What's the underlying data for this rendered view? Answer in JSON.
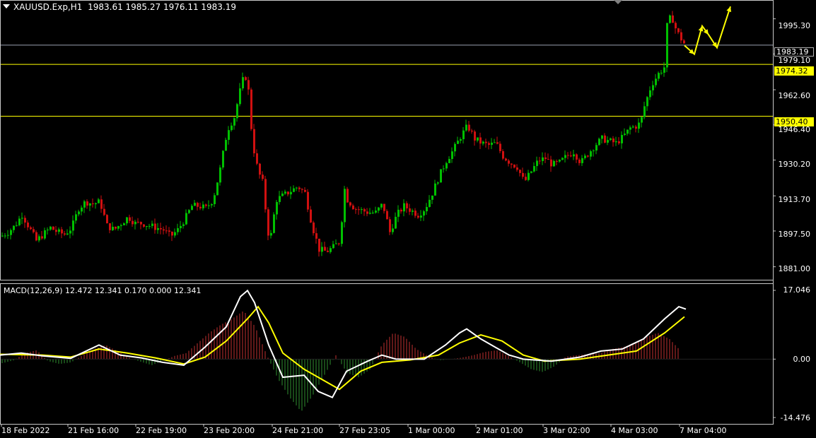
{
  "symbol_bar": {
    "symbol": "XAUUSD.Exp,H1",
    "ohlc": "1983.61 1985.27 1976.11 1983.19"
  },
  "macd_bar": {
    "label": "MACD(12,26,9) 12.472 12.341 0.170 0.000 12.341"
  },
  "price_axis": {
    "ticks": [
      "1995.30",
      "1979.10",
      "1962.60",
      "1946.40",
      "1930.20",
      "1913.70",
      "1897.50",
      "1881.00"
    ],
    "current_tag": "1983.19",
    "level_tags": [
      "1974.32",
      "1950.40"
    ]
  },
  "macd_axis": {
    "ticks": [
      "17.046",
      "0.00",
      "-14.476"
    ]
  },
  "time_axis": {
    "labels": [
      "18 Feb 2022",
      "21 Feb 16:00",
      "22 Feb 19:00",
      "23 Feb 20:00",
      "24 Feb 21:00",
      "27 Feb 23:05",
      "1 Mar 00:00",
      "2 Mar 01:00",
      "3 Mar 02:00",
      "4 Mar 03:00",
      "7 Mar 04:00"
    ]
  },
  "colors": {
    "background": "#000000",
    "bull": "#00c000",
    "bear": "#d01010",
    "level_line": "#ffff00",
    "current_line": "#9aa0b0",
    "macd_main": "#ffffff",
    "macd_signal": "#ffff00",
    "forecast_arrow": "#ffff00"
  },
  "chart_data": {
    "type": "candlestick",
    "instrument": "XAUUSD.Exp",
    "timeframe": "H1",
    "ylim": [
      1876,
      2003
    ],
    "horizontal_levels": [
      1974.32,
      1950.4
    ],
    "current_price": 1983.19,
    "price_path": [
      [
        0,
        1895
      ],
      [
        10,
        1897
      ],
      [
        20,
        1900
      ],
      [
        30,
        1905
      ],
      [
        40,
        1899
      ],
      [
        50,
        1893
      ],
      [
        60,
        1896
      ],
      [
        70,
        1899
      ],
      [
        80,
        1897
      ],
      [
        90,
        1896
      ],
      [
        100,
        1899
      ],
      [
        110,
        1908
      ],
      [
        120,
        1911
      ],
      [
        130,
        1910
      ],
      [
        140,
        1911
      ],
      [
        150,
        1900
      ],
      [
        160,
        1898
      ],
      [
        170,
        1901
      ],
      [
        180,
        1904
      ],
      [
        190,
        1901
      ],
      [
        200,
        1901
      ],
      [
        210,
        1900
      ],
      [
        220,
        1899
      ],
      [
        230,
        1898
      ],
      [
        240,
        1895
      ],
      [
        250,
        1898
      ],
      [
        260,
        1903
      ],
      [
        270,
        1909
      ],
      [
        280,
        1909
      ],
      [
        290,
        1908
      ],
      [
        300,
        1912
      ],
      [
        310,
        1926
      ],
      [
        320,
        1944
      ],
      [
        330,
        1950
      ],
      [
        340,
        1965
      ],
      [
        345,
        1970
      ],
      [
        350,
        1962
      ],
      [
        355,
        1941
      ],
      [
        360,
        1930
      ],
      [
        365,
        1924
      ],
      [
        370,
        1920
      ],
      [
        375,
        1905
      ],
      [
        380,
        1891
      ],
      [
        385,
        1903
      ],
      [
        390,
        1912
      ],
      [
        400,
        1914
      ],
      [
        410,
        1916
      ],
      [
        420,
        1918
      ],
      [
        430,
        1915
      ],
      [
        440,
        1900
      ],
      [
        450,
        1889
      ],
      [
        460,
        1888
      ],
      [
        470,
        1890
      ],
      [
        480,
        1893
      ],
      [
        485,
        1918
      ],
      [
        490,
        1912
      ],
      [
        500,
        1908
      ],
      [
        510,
        1907
      ],
      [
        520,
        1906
      ],
      [
        530,
        1906
      ],
      [
        540,
        1910
      ],
      [
        550,
        1897
      ],
      [
        560,
        1905
      ],
      [
        570,
        1909
      ],
      [
        580,
        1907
      ],
      [
        590,
        1905
      ],
      [
        600,
        1908
      ],
      [
        610,
        1915
      ],
      [
        620,
        1923
      ],
      [
        630,
        1930
      ],
      [
        640,
        1935
      ],
      [
        650,
        1941
      ],
      [
        660,
        1946
      ],
      [
        670,
        1940
      ],
      [
        680,
        1938
      ],
      [
        690,
        1937
      ],
      [
        700,
        1938
      ],
      [
        710,
        1932
      ],
      [
        720,
        1929
      ],
      [
        730,
        1927
      ],
      [
        740,
        1920
      ],
      [
        750,
        1925
      ],
      [
        760,
        1930
      ],
      [
        770,
        1931
      ],
      [
        780,
        1928
      ],
      [
        790,
        1929
      ],
      [
        800,
        1932
      ],
      [
        810,
        1934
      ],
      [
        820,
        1929
      ],
      [
        830,
        1933
      ],
      [
        840,
        1937
      ],
      [
        850,
        1940
      ],
      [
        860,
        1939
      ],
      [
        870,
        1938
      ],
      [
        880,
        1941
      ],
      [
        890,
        1945
      ],
      [
        900,
        1946
      ],
      [
        905,
        1948
      ],
      [
        910,
        1955
      ],
      [
        920,
        1965
      ],
      [
        930,
        1970
      ],
      [
        938,
        1973
      ],
      [
        942,
        1992
      ],
      [
        948,
        1997
      ],
      [
        955,
        1990
      ],
      [
        962,
        1986
      ],
      [
        968,
        1983
      ]
    ],
    "macd_path": [
      [
        0,
        1.0
      ],
      [
        30,
        1.5
      ],
      [
        60,
        0.8
      ],
      [
        100,
        0.2
      ],
      [
        140,
        3.5
      ],
      [
        170,
        1.0
      ],
      [
        200,
        0.3
      ],
      [
        230,
        -0.8
      ],
      [
        260,
        -1.5
      ],
      [
        290,
        3.0
      ],
      [
        320,
        8.0
      ],
      [
        340,
        15.5
      ],
      [
        350,
        17.0
      ],
      [
        360,
        14.0
      ],
      [
        380,
        3.5
      ],
      [
        400,
        -4.5
      ],
      [
        430,
        -4.0
      ],
      [
        450,
        -8.0
      ],
      [
        470,
        -9.5
      ],
      [
        490,
        -3.0
      ],
      [
        520,
        -0.5
      ],
      [
        540,
        1.0
      ],
      [
        560,
        0.0
      ],
      [
        600,
        0.0
      ],
      [
        630,
        3.5
      ],
      [
        650,
        6.5
      ],
      [
        660,
        7.5
      ],
      [
        680,
        5.0
      ],
      [
        700,
        3.0
      ],
      [
        720,
        1.0
      ],
      [
        740,
        0.0
      ],
      [
        780,
        -0.5
      ],
      [
        820,
        0.5
      ],
      [
        850,
        2.0
      ],
      [
        880,
        2.5
      ],
      [
        910,
        5.0
      ],
      [
        940,
        10.0
      ],
      [
        960,
        13.0
      ],
      [
        970,
        12.4
      ]
    ],
    "signal_path": [
      [
        0,
        1.2
      ],
      [
        60,
        1.0
      ],
      [
        100,
        0.5
      ],
      [
        140,
        2.5
      ],
      [
        180,
        1.5
      ],
      [
        220,
        0.3
      ],
      [
        260,
        -1.2
      ],
      [
        290,
        0.5
      ],
      [
        320,
        4.5
      ],
      [
        350,
        10.0
      ],
      [
        365,
        13.0
      ],
      [
        380,
        9.0
      ],
      [
        400,
        1.5
      ],
      [
        430,
        -2.5
      ],
      [
        460,
        -5.5
      ],
      [
        480,
        -7.5
      ],
      [
        510,
        -3.0
      ],
      [
        540,
        -0.8
      ],
      [
        580,
        -0.2
      ],
      [
        620,
        1.0
      ],
      [
        650,
        4.0
      ],
      [
        680,
        6.0
      ],
      [
        710,
        4.5
      ],
      [
        740,
        1.0
      ],
      [
        770,
        -0.5
      ],
      [
        820,
        0.0
      ],
      [
        860,
        1.0
      ],
      [
        900,
        2.0
      ],
      [
        940,
        6.5
      ],
      [
        968,
        10.5
      ]
    ],
    "histogram": [
      [
        -1.0,
        -0.3,
        1.5,
        2.2,
        -0.5,
        -1.2,
        -0.8,
        1.0,
        2.5,
        3.5,
        2.0,
        0.4,
        -0.6,
        -1.5,
        -0.4,
        0.8,
        1.5,
        4.0,
        6.5,
        8.5,
        10.0,
        12.0,
        8.0,
        1.0,
        -5.0,
        -9.5,
        -13.0,
        -9.0,
        -4.0,
        1.0,
        -3.5,
        -4.5,
        -2.5,
        3.5,
        6.5,
        5.5,
        2.5,
        0.8,
        -0.3,
        0.0,
        0.4,
        1.0,
        1.8,
        2.2,
        0.8,
        -0.8,
        -2.5,
        -3.2,
        -1.8,
        0.6,
        1.0,
        1.2,
        1.5,
        2.5,
        3.0,
        4.0,
        5.5,
        6.5,
        5.0,
        2.0
      ]
    ],
    "macd_ylim": [
      -14.476,
      17.046
    ]
  }
}
